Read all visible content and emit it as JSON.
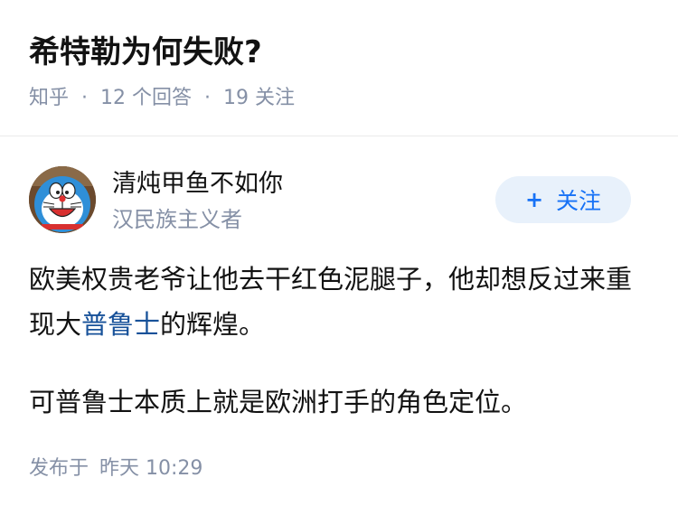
{
  "question": {
    "title": "希特勒为何失败?",
    "source": "知乎",
    "separator": "·",
    "answers": "12 个回答",
    "followers": "19 关注"
  },
  "author": {
    "name": "清炖甲鱼不如你",
    "badge": "汉民族主义者",
    "avatar_icon": "doraemon-avatar",
    "follow_label": "关注",
    "follow_icon": "plus-icon"
  },
  "answer": {
    "paragraph1_before": "欧美权贵老爷让他去干红色泥腿子，他却想反过来重现大",
    "paragraph1_link": "普鲁士",
    "paragraph1_after": "的辉煌。",
    "paragraph2": "可普鲁士本质上就是欧洲打手的角色定位。"
  },
  "footer": {
    "published_label": "发布于",
    "published_time": "昨天 10:29"
  },
  "colors": {
    "link": "#175199",
    "accent": "#1772f6",
    "follow_bg": "#e8f1fb",
    "meta": "#8590a6"
  }
}
